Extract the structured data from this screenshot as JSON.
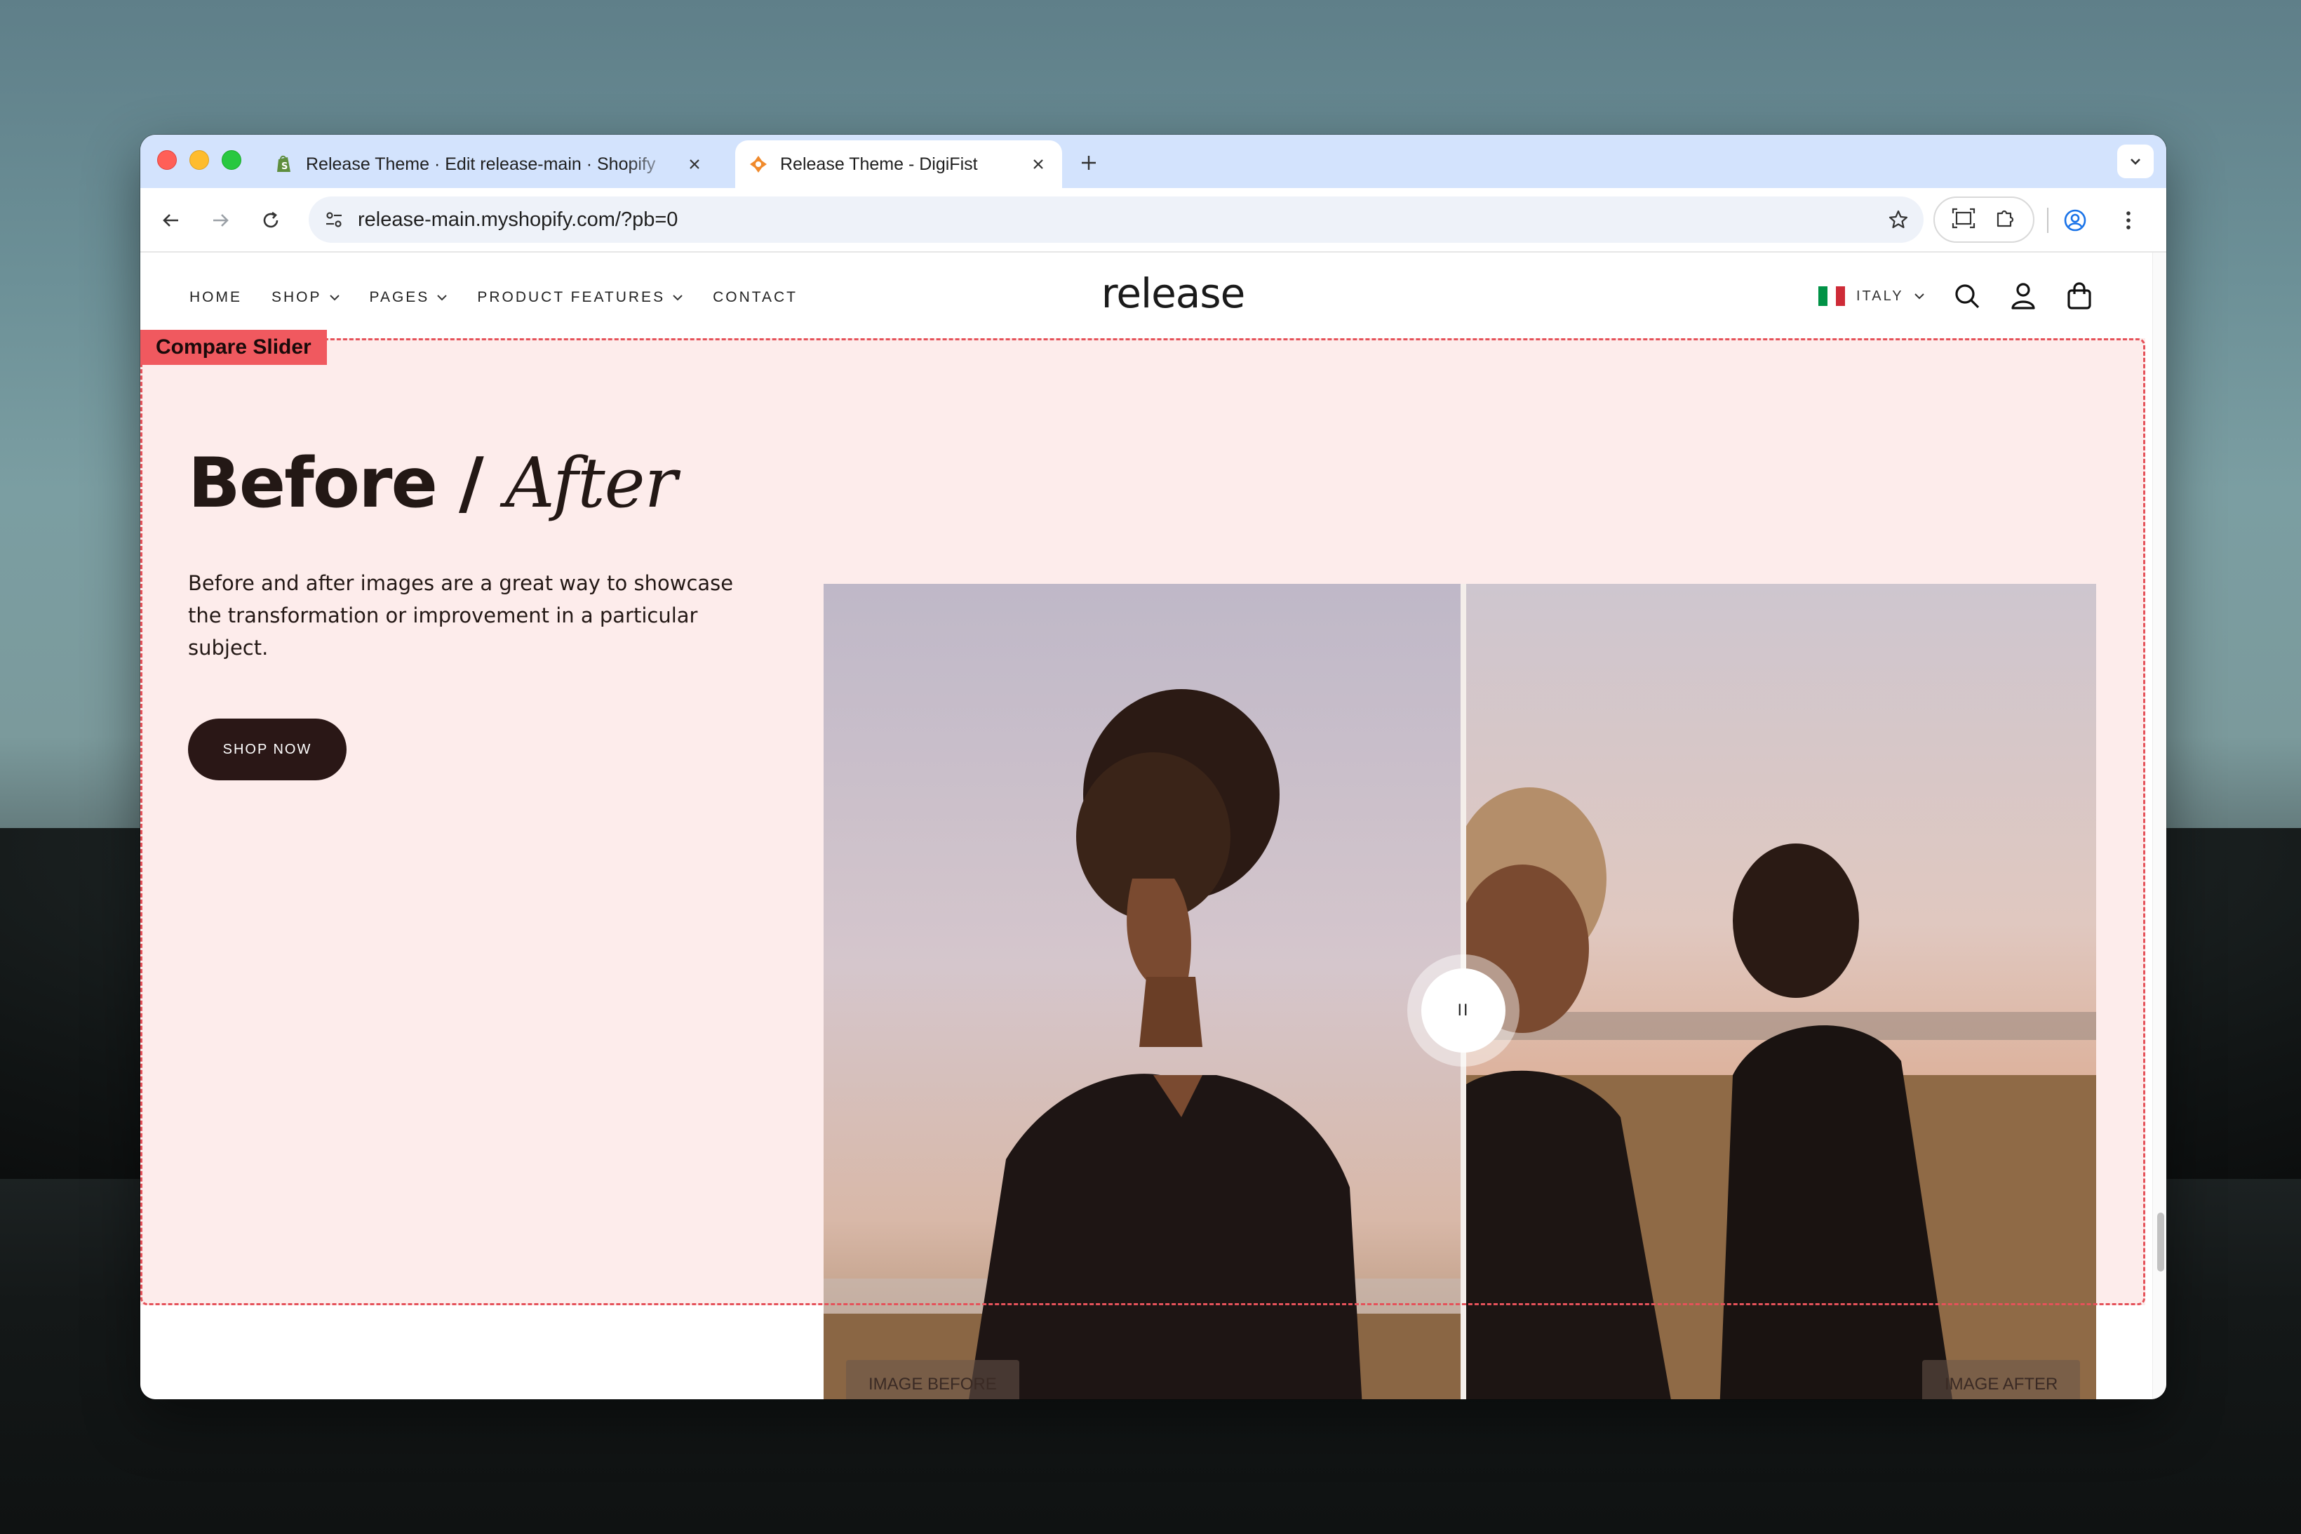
{
  "browser": {
    "tabs": [
      {
        "title": "Release Theme · Edit release-main · Shopify",
        "favicon": "shopify-icon",
        "active": false
      },
      {
        "title": "Release Theme - DigiFist",
        "favicon": "digifist-icon",
        "active": true
      }
    ],
    "url": "release-main.myshopify.com/?pb=0"
  },
  "site": {
    "nav": [
      {
        "label": "HOME",
        "dropdown": false
      },
      {
        "label": "SHOP",
        "dropdown": true
      },
      {
        "label": "PAGES",
        "dropdown": true
      },
      {
        "label": "PRODUCT FEATURES",
        "dropdown": true
      },
      {
        "label": "CONTACT",
        "dropdown": false
      }
    ],
    "logo": "release",
    "country": "ITALY",
    "country_flag_colors": [
      "#009246",
      "#ffffff",
      "#ce2b37"
    ]
  },
  "section": {
    "badge": "Compare Slider",
    "heading_part1": "Before /",
    "heading_part2": "After",
    "description": "Before and after images are a great way to showcase the transformation or improvement in a particular subject.",
    "button": "SHOP NOW",
    "handle": "II",
    "label_before": "IMAGE BEFORE",
    "label_after": "IMAGE AFTER"
  },
  "colors": {
    "section_bg": "#fdeceb",
    "outline": "#e5525a",
    "badge_bg": "#f0595f",
    "button_bg": "#2a1716"
  }
}
